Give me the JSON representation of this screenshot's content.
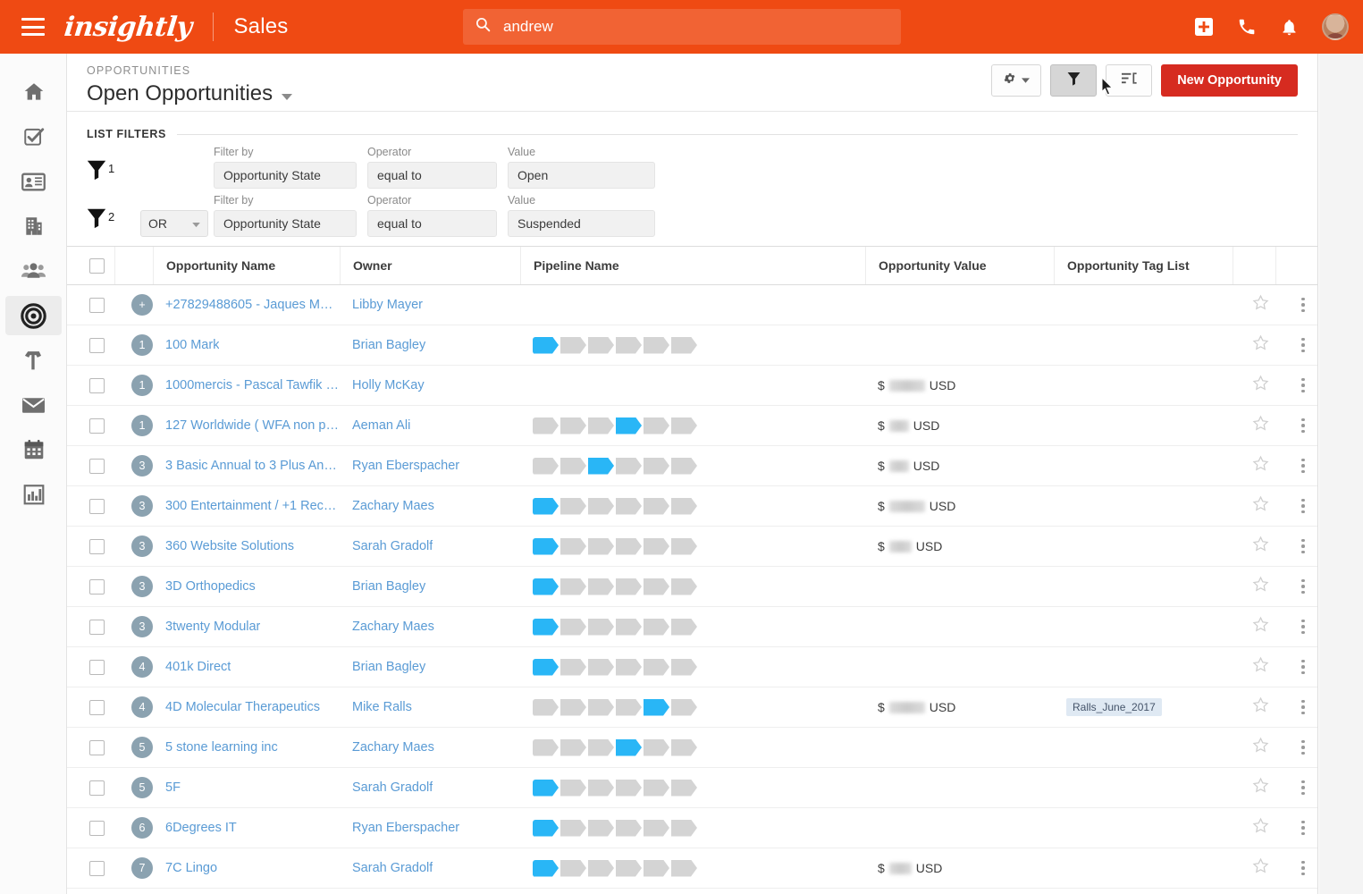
{
  "topbar": {
    "brand": "insightly",
    "app_name": "Sales",
    "search_value": "andrew",
    "search_placeholder": "Search",
    "menu_icon": "hamburger-icon",
    "add_icon": "add-box-icon",
    "phone_icon": "phone-icon",
    "bell_icon": "notifications-icon",
    "avatar_icon": "user-avatar",
    "accent_color": "#ef4a13"
  },
  "sidebar": {
    "items": [
      {
        "name": "home",
        "icon": "home-icon",
        "active": false
      },
      {
        "name": "tasks",
        "icon": "task-check-icon",
        "active": false
      },
      {
        "name": "contacts",
        "icon": "contact-card-icon",
        "active": false
      },
      {
        "name": "organizations",
        "icon": "building-icon",
        "active": false
      },
      {
        "name": "leads",
        "icon": "people-icon",
        "active": false
      },
      {
        "name": "opportunities",
        "icon": "target-icon",
        "active": true
      },
      {
        "name": "projects",
        "icon": "hammer-icon",
        "active": false
      },
      {
        "name": "emails",
        "icon": "envelope-icon",
        "active": false
      },
      {
        "name": "calendar",
        "icon": "calendar-icon",
        "active": false
      },
      {
        "name": "reports",
        "icon": "bar-chart-icon",
        "active": false
      }
    ]
  },
  "page": {
    "eyebrow": "OPPORTUNITIES",
    "title": "Open Opportunities",
    "actions": {
      "settings_label": "",
      "settings_icon": "gear-icon",
      "filter_icon": "funnel-icon",
      "sort_icon": "sort-icon",
      "new_button": "New Opportunity",
      "new_button_color": "#d62b20"
    }
  },
  "filters": {
    "section_title": "LIST FILTERS",
    "labels": {
      "filter_by": "Filter by",
      "operator": "Operator",
      "value": "Value"
    },
    "rows": [
      {
        "index": "1",
        "conjunction": null,
        "filter_by": "Opportunity State",
        "operator": "equal to",
        "value": "Open"
      },
      {
        "index": "2",
        "conjunction": "OR",
        "filter_by": "Opportunity State",
        "operator": "equal to",
        "value": "Suspended"
      }
    ]
  },
  "table": {
    "columns": [
      "Opportunity Name",
      "Owner",
      "Pipeline Name",
      "Opportunity Value",
      "Opportunity Tag List"
    ],
    "pipeline_stage_count": 6,
    "rows": [
      {
        "badge": "+",
        "name": "+27829488605 - Jaques M…",
        "owner": "Libby Mayer",
        "stage": 0,
        "value_prefix": "",
        "value_width": 0,
        "value_suffix": "",
        "tag": ""
      },
      {
        "badge": "1",
        "name": "100 Mark",
        "owner": "Brian Bagley",
        "stage": 1,
        "value_prefix": "",
        "value_width": 0,
        "value_suffix": "",
        "tag": ""
      },
      {
        "badge": "1",
        "name": "1000mercis - Pascal Tawfik …",
        "owner": "Holly McKay",
        "stage": 0,
        "value_prefix": "$",
        "value_width": 40,
        "value_suffix": "USD",
        "tag": ""
      },
      {
        "badge": "1",
        "name": "127 Worldwide ( WFA non p…",
        "owner": "Aeman Ali",
        "stage": 4,
        "value_prefix": "$",
        "value_width": 22,
        "value_suffix": "USD",
        "tag": ""
      },
      {
        "badge": "3",
        "name": "3 Basic Annual to 3 Plus An…",
        "owner": "Ryan Eberspacher",
        "stage": 3,
        "value_prefix": "$",
        "value_width": 22,
        "value_suffix": "USD",
        "tag": ""
      },
      {
        "badge": "3",
        "name": "300 Entertainment / +1 Rec…",
        "owner": "Zachary Maes",
        "stage": 1,
        "value_prefix": "$",
        "value_width": 40,
        "value_suffix": "USD",
        "tag": ""
      },
      {
        "badge": "3",
        "name": "360 Website Solutions",
        "owner": "Sarah Gradolf",
        "stage": 1,
        "value_prefix": "$",
        "value_width": 25,
        "value_suffix": "USD",
        "tag": ""
      },
      {
        "badge": "3",
        "name": "3D Orthopedics",
        "owner": "Brian Bagley",
        "stage": 1,
        "value_prefix": "",
        "value_width": 0,
        "value_suffix": "",
        "tag": ""
      },
      {
        "badge": "3",
        "name": "3twenty Modular",
        "owner": "Zachary Maes",
        "stage": 1,
        "value_prefix": "",
        "value_width": 0,
        "value_suffix": "",
        "tag": ""
      },
      {
        "badge": "4",
        "name": "401k Direct",
        "owner": "Brian Bagley",
        "stage": 1,
        "value_prefix": "",
        "value_width": 0,
        "value_suffix": "",
        "tag": ""
      },
      {
        "badge": "4",
        "name": "4D Molecular Therapeutics",
        "owner": "Mike Ralls",
        "stage": 5,
        "value_prefix": "$",
        "value_width": 40,
        "value_suffix": "USD",
        "tag": "Ralls_June_2017"
      },
      {
        "badge": "5",
        "name": "5 stone learning inc",
        "owner": "Zachary Maes",
        "stage": 4,
        "value_prefix": "",
        "value_width": 0,
        "value_suffix": "",
        "tag": ""
      },
      {
        "badge": "5",
        "name": "5F",
        "owner": "Sarah Gradolf",
        "stage": 1,
        "value_prefix": "",
        "value_width": 0,
        "value_suffix": "",
        "tag": ""
      },
      {
        "badge": "6",
        "name": "6Degrees IT",
        "owner": "Ryan Eberspacher",
        "stage": 1,
        "value_prefix": "",
        "value_width": 0,
        "value_suffix": "",
        "tag": ""
      },
      {
        "badge": "7",
        "name": "7C Lingo",
        "owner": "Sarah Gradolf",
        "stage": 1,
        "value_prefix": "$",
        "value_width": 25,
        "value_suffix": "USD",
        "tag": ""
      }
    ]
  }
}
